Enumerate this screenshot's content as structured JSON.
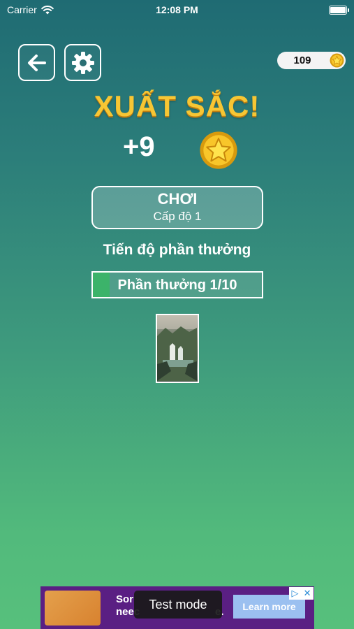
{
  "status_bar": {
    "carrier": "Carrier",
    "time": "12:08 PM"
  },
  "coins": {
    "balance": "109"
  },
  "result": {
    "title": "XUẤT SẮC!",
    "reward": "+9"
  },
  "play_button": {
    "label": "CHƠI",
    "level": "Cấp độ 1"
  },
  "progress": {
    "title": "Tiến độ phần thưởng",
    "label": "Phần thưởng 1/10",
    "fraction": 0.1
  },
  "ad": {
    "text_line1": "Sor",
    "text_line2": "neec",
    "text_tail": "e.",
    "learn_more": "Learn more",
    "test_mode": "Test mode"
  },
  "icons": {
    "back": "arrow-left-icon",
    "settings": "gear-icon",
    "coin": "star-coin-icon",
    "wifi": "wifi-icon",
    "battery": "battery-icon"
  },
  "colors": {
    "title": "#f7c634",
    "progress_fill": "#3cb36a",
    "ad_bg": "#5a1f83"
  }
}
